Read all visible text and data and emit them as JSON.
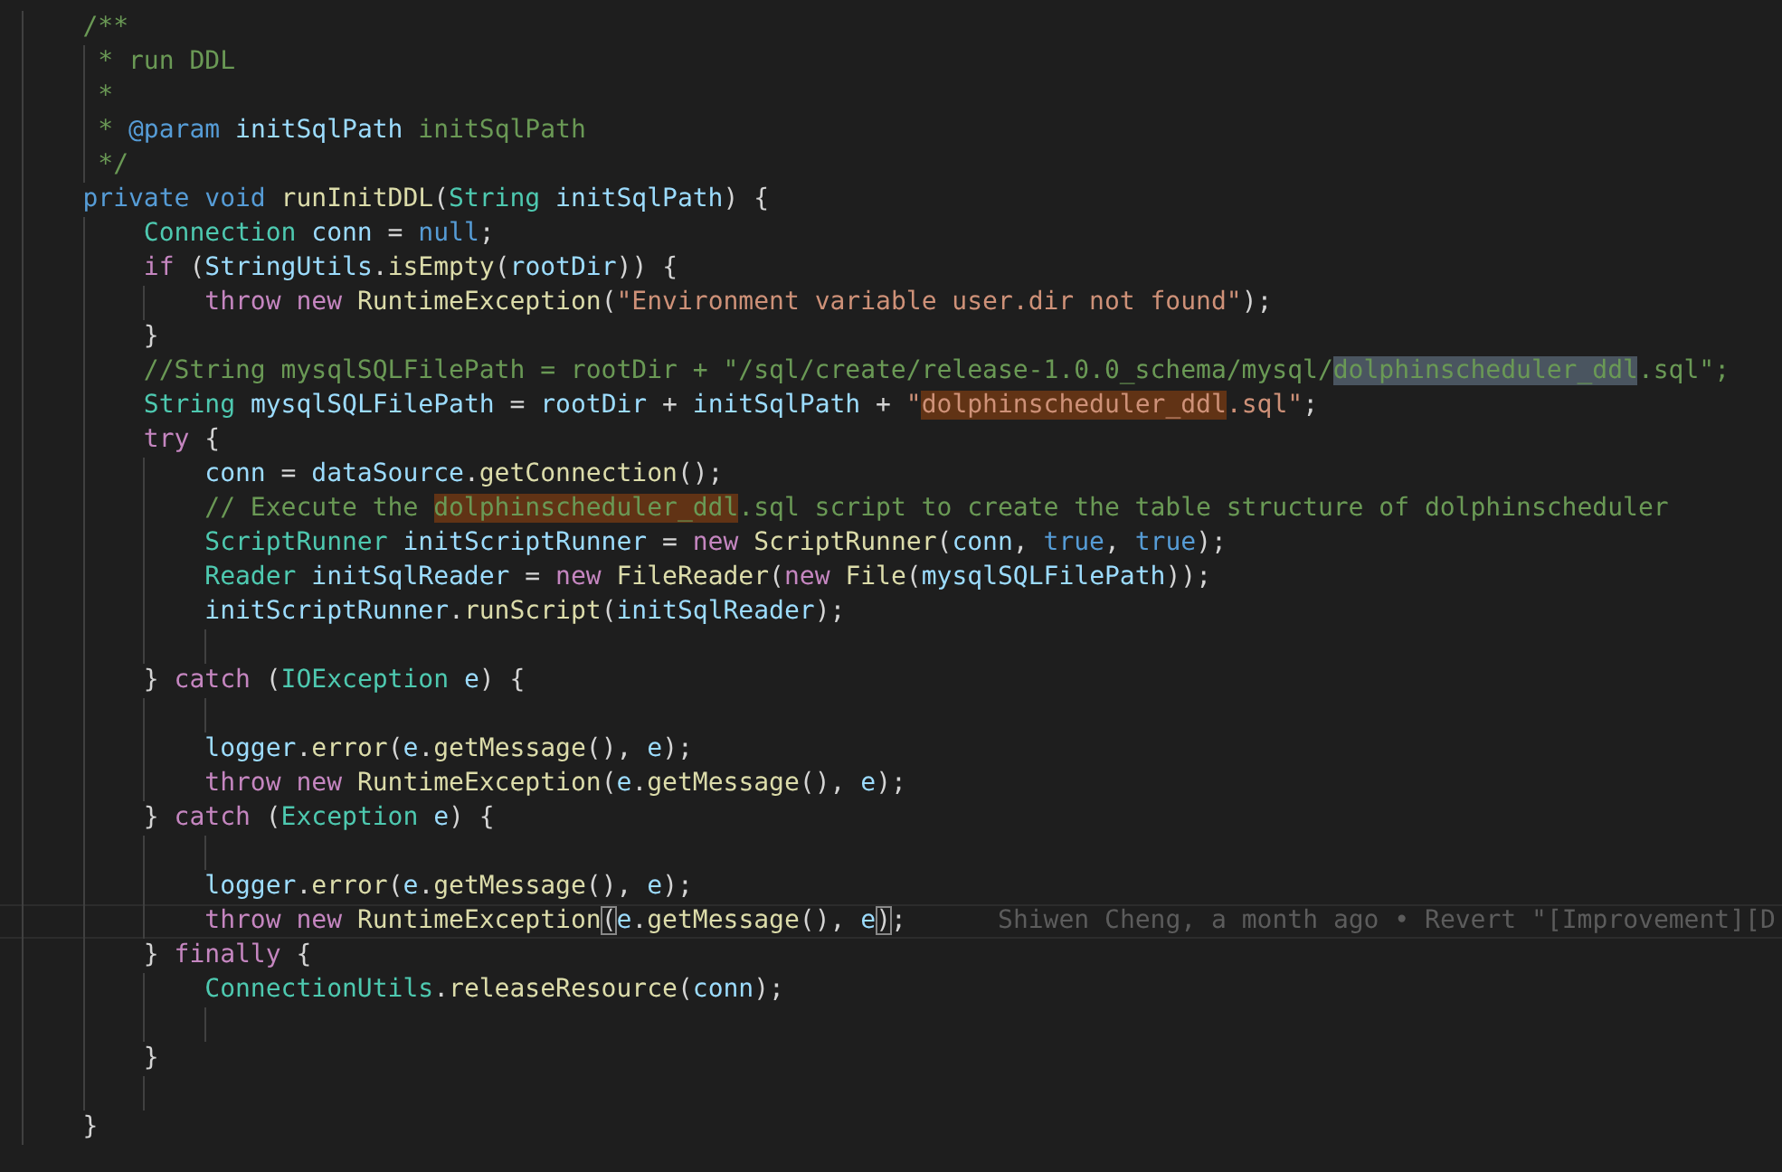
{
  "editor": {
    "lines": [
      {
        "current": false,
        "tokens": [
          {
            "kind": "comment",
            "text": "    /**"
          }
        ]
      },
      {
        "current": false,
        "tokens": [
          {
            "kind": "comment",
            "text": "     * run DDL"
          }
        ]
      },
      {
        "current": false,
        "tokens": [
          {
            "kind": "comment",
            "text": "     *"
          }
        ]
      },
      {
        "current": false,
        "tokens": [
          {
            "kind": "comment",
            "text": "     *"
          },
          {
            "kind": "tag",
            "text": " @param"
          },
          {
            "kind": "var",
            "text": " initSqlPath"
          },
          {
            "kind": "comment",
            "text": " initSqlPath"
          }
        ]
      },
      {
        "current": false,
        "tokens": [
          {
            "kind": "comment",
            "text": "     */"
          }
        ]
      },
      {
        "current": false,
        "tokens": [
          {
            "kind": "mod",
            "text": "    private void"
          },
          {
            "kind": "fn",
            "text": " runInitDDL"
          },
          {
            "kind": "plain",
            "text": "("
          },
          {
            "kind": "type",
            "text": "String"
          },
          {
            "kind": "var",
            "text": " initSqlPath"
          },
          {
            "kind": "plain",
            "text": ") {"
          }
        ]
      },
      {
        "current": false,
        "tokens": [
          {
            "kind": "type",
            "text": "        Connection"
          },
          {
            "kind": "var",
            "text": " conn"
          },
          {
            "kind": "plain",
            "text": " ="
          },
          {
            "kind": "mod",
            "text": " null"
          },
          {
            "kind": "plain",
            "text": ";"
          }
        ]
      },
      {
        "current": false,
        "tokens": [
          {
            "kind": "kw",
            "text": "        if"
          },
          {
            "kind": "plain",
            "text": " ("
          },
          {
            "kind": "var",
            "text": "StringUtils"
          },
          {
            "kind": "plain",
            "text": "."
          },
          {
            "kind": "fn",
            "text": "isEmpty"
          },
          {
            "kind": "plain",
            "text": "("
          },
          {
            "kind": "var",
            "text": "rootDir"
          },
          {
            "kind": "plain",
            "text": ")) {"
          }
        ]
      },
      {
        "current": false,
        "tokens": [
          {
            "kind": "kw",
            "text": "            throw new"
          },
          {
            "kind": "fn",
            "text": " RuntimeException"
          },
          {
            "kind": "plain",
            "text": "("
          },
          {
            "kind": "str",
            "text": "\"Environment variable user.dir not found\""
          },
          {
            "kind": "plain",
            "text": ");"
          }
        ]
      },
      {
        "current": false,
        "tokens": [
          {
            "kind": "plain",
            "text": "        }"
          }
        ]
      },
      {
        "current": false,
        "tokens": [
          {
            "kind": "comment",
            "text": "        //String mysqlSQLFilePath = rootDir + \"/sql/create/release-1.0.0_schema/mysql/"
          },
          {
            "kind": "comment",
            "text": "dolphinscheduler_ddl",
            "selection_match": true
          },
          {
            "kind": "comment",
            "text": ".sql\";"
          }
        ]
      },
      {
        "current": false,
        "tokens": [
          {
            "kind": "type",
            "text": "        String"
          },
          {
            "kind": "var",
            "text": " mysqlSQLFilePath"
          },
          {
            "kind": "plain",
            "text": " ="
          },
          {
            "kind": "var",
            "text": " rootDir"
          },
          {
            "kind": "plain",
            "text": " +"
          },
          {
            "kind": "var",
            "text": " initSqlPath"
          },
          {
            "kind": "plain",
            "text": " +"
          },
          {
            "kind": "str",
            "text": " \""
          },
          {
            "kind": "str",
            "text": "dolphinscheduler_ddl",
            "find_match": true
          },
          {
            "kind": "str",
            "text": ".sql\""
          },
          {
            "kind": "plain",
            "text": ";"
          }
        ]
      },
      {
        "current": false,
        "tokens": [
          {
            "kind": "kw",
            "text": "        try"
          },
          {
            "kind": "plain",
            "text": " {"
          }
        ]
      },
      {
        "current": false,
        "tokens": [
          {
            "kind": "var",
            "text": "            conn"
          },
          {
            "kind": "plain",
            "text": " ="
          },
          {
            "kind": "var",
            "text": " dataSource"
          },
          {
            "kind": "plain",
            "text": "."
          },
          {
            "kind": "fn",
            "text": "getConnection"
          },
          {
            "kind": "plain",
            "text": "();"
          }
        ]
      },
      {
        "current": false,
        "tokens": [
          {
            "kind": "comment",
            "text": "            // Execute the "
          },
          {
            "kind": "comment",
            "text": "dolphinscheduler_ddl",
            "find_match": true
          },
          {
            "kind": "comment",
            "text": ".sql script to create the table structure of dolphinscheduler"
          }
        ]
      },
      {
        "current": false,
        "tokens": [
          {
            "kind": "type",
            "text": "            ScriptRunner"
          },
          {
            "kind": "var",
            "text": " initScriptRunner"
          },
          {
            "kind": "plain",
            "text": " ="
          },
          {
            "kind": "kw",
            "text": " new"
          },
          {
            "kind": "fn",
            "text": " ScriptRunner"
          },
          {
            "kind": "plain",
            "text": "("
          },
          {
            "kind": "var",
            "text": "conn"
          },
          {
            "kind": "plain",
            "text": ","
          },
          {
            "kind": "mod",
            "text": " true"
          },
          {
            "kind": "plain",
            "text": ","
          },
          {
            "kind": "mod",
            "text": " true"
          },
          {
            "kind": "plain",
            "text": ");"
          }
        ]
      },
      {
        "current": false,
        "tokens": [
          {
            "kind": "type",
            "text": "            Reader"
          },
          {
            "kind": "var",
            "text": " initSqlReader"
          },
          {
            "kind": "plain",
            "text": " ="
          },
          {
            "kind": "kw",
            "text": " new"
          },
          {
            "kind": "fn",
            "text": " FileReader"
          },
          {
            "kind": "plain",
            "text": "("
          },
          {
            "kind": "kw",
            "text": "new"
          },
          {
            "kind": "fn",
            "text": " File"
          },
          {
            "kind": "plain",
            "text": "("
          },
          {
            "kind": "var",
            "text": "mysqlSQLFilePath"
          },
          {
            "kind": "plain",
            "text": "));"
          }
        ]
      },
      {
        "current": false,
        "tokens": [
          {
            "kind": "var",
            "text": "            initScriptRunner"
          },
          {
            "kind": "plain",
            "text": "."
          },
          {
            "kind": "fn",
            "text": "runScript"
          },
          {
            "kind": "plain",
            "text": "("
          },
          {
            "kind": "var",
            "text": "initSqlReader"
          },
          {
            "kind": "plain",
            "text": ");"
          }
        ]
      },
      {
        "current": false
      },
      {
        "current": false,
        "tokens": [
          {
            "kind": "plain",
            "text": "        }"
          },
          {
            "kind": "kw",
            "text": " catch"
          },
          {
            "kind": "plain",
            "text": " ("
          },
          {
            "kind": "type",
            "text": "IOException"
          },
          {
            "kind": "var",
            "text": " e"
          },
          {
            "kind": "plain",
            "text": ") {"
          }
        ]
      },
      {
        "current": false
      },
      {
        "current": false,
        "tokens": [
          {
            "kind": "var",
            "text": "            logger"
          },
          {
            "kind": "plain",
            "text": "."
          },
          {
            "kind": "fn",
            "text": "error"
          },
          {
            "kind": "plain",
            "text": "("
          },
          {
            "kind": "var",
            "text": "e"
          },
          {
            "kind": "plain",
            "text": "."
          },
          {
            "kind": "fn",
            "text": "getMessage"
          },
          {
            "kind": "plain",
            "text": "(),"
          },
          {
            "kind": "var",
            "text": " e"
          },
          {
            "kind": "plain",
            "text": ");"
          }
        ]
      },
      {
        "current": false,
        "tokens": [
          {
            "kind": "kw",
            "text": "            throw new"
          },
          {
            "kind": "fn",
            "text": " RuntimeException"
          },
          {
            "kind": "plain",
            "text": "("
          },
          {
            "kind": "var",
            "text": "e"
          },
          {
            "kind": "plain",
            "text": "."
          },
          {
            "kind": "fn",
            "text": "getMessage"
          },
          {
            "kind": "plain",
            "text": "(),"
          },
          {
            "kind": "var",
            "text": " e"
          },
          {
            "kind": "plain",
            "text": ");"
          }
        ]
      },
      {
        "current": false,
        "tokens": [
          {
            "kind": "plain",
            "text": "        }"
          },
          {
            "kind": "kw",
            "text": " catch"
          },
          {
            "kind": "plain",
            "text": " ("
          },
          {
            "kind": "type",
            "text": "Exception"
          },
          {
            "kind": "var",
            "text": " e"
          },
          {
            "kind": "plain",
            "text": ") {"
          }
        ]
      },
      {
        "current": false
      },
      {
        "current": false,
        "tokens": [
          {
            "kind": "var",
            "text": "            logger"
          },
          {
            "kind": "plain",
            "text": "."
          },
          {
            "kind": "fn",
            "text": "error"
          },
          {
            "kind": "plain",
            "text": "("
          },
          {
            "kind": "var",
            "text": "e"
          },
          {
            "kind": "plain",
            "text": "."
          },
          {
            "kind": "fn",
            "text": "getMessage"
          },
          {
            "kind": "plain",
            "text": "(),"
          },
          {
            "kind": "var",
            "text": " e"
          },
          {
            "kind": "plain",
            "text": ");"
          }
        ]
      },
      {
        "current": true,
        "tokens": [
          {
            "kind": "kw",
            "text": "            throw new"
          },
          {
            "kind": "fn",
            "text": " RuntimeException"
          },
          {
            "kind": "plain",
            "text": "(",
            "bracket_match": true
          },
          {
            "kind": "var",
            "text": "e"
          },
          {
            "kind": "plain",
            "text": "."
          },
          {
            "kind": "fn",
            "text": "getMessage"
          },
          {
            "kind": "plain",
            "text": "(),"
          },
          {
            "kind": "var",
            "text": " e"
          },
          {
            "kind": "plain",
            "text": ")",
            "bracket_match": true
          },
          {
            "kind": "plain",
            "text": ";"
          }
        ],
        "blame": "Shiwen Cheng, a month ago • Revert \"[Improvement][D"
      },
      {
        "current": false,
        "tokens": [
          {
            "kind": "plain",
            "text": "        }"
          },
          {
            "kind": "kw",
            "text": " finally"
          },
          {
            "kind": "plain",
            "text": " {"
          }
        ]
      },
      {
        "current": false,
        "tokens": [
          {
            "kind": "type",
            "text": "            ConnectionUtils"
          },
          {
            "kind": "plain",
            "text": "."
          },
          {
            "kind": "fn",
            "text": "releaseResource"
          },
          {
            "kind": "plain",
            "text": "("
          },
          {
            "kind": "var",
            "text": "conn"
          },
          {
            "kind": "plain",
            "text": ");"
          }
        ]
      },
      {
        "current": false
      },
      {
        "current": false,
        "tokens": [
          {
            "kind": "plain",
            "text": "        }"
          }
        ]
      },
      {
        "current": false
      },
      {
        "current": false,
        "tokens": [
          {
            "kind": "plain",
            "text": "    }"
          }
        ]
      }
    ]
  }
}
